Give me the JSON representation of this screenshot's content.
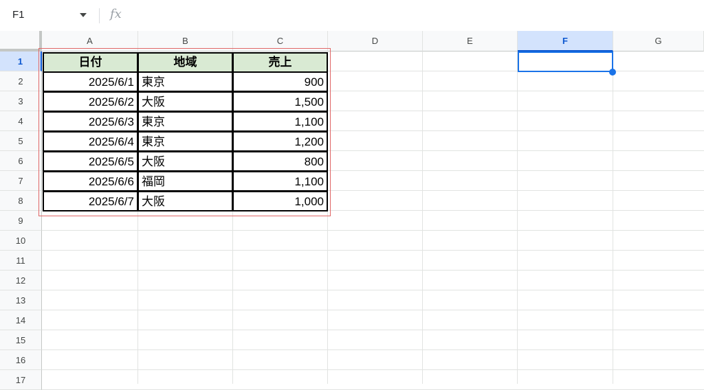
{
  "formula_bar": {
    "name_box": "F1",
    "fx": "fx",
    "formula": ""
  },
  "columns": [
    "A",
    "B",
    "C",
    "D",
    "E",
    "F",
    "G"
  ],
  "selected_column": "F",
  "rows": [
    "1",
    "2",
    "3",
    "4",
    "5",
    "6",
    "7",
    "8",
    "9",
    "10",
    "11",
    "12",
    "13",
    "14",
    "15",
    "16",
    "17"
  ],
  "selected_row": "1",
  "table": {
    "headers": [
      "日付",
      "地域",
      "売上"
    ],
    "rows": [
      [
        "2025/6/1",
        "東京",
        "900"
      ],
      [
        "2025/6/2",
        "大阪",
        "1,500"
      ],
      [
        "2025/6/3",
        "東京",
        "1,100"
      ],
      [
        "2025/6/4",
        "東京",
        "1,200"
      ],
      [
        "2025/6/5",
        "大阪",
        "800"
      ],
      [
        "2025/6/6",
        "福岡",
        "1,100"
      ],
      [
        "2025/6/7",
        "大阪",
        "1,000"
      ]
    ],
    "header_fill": "#d9ead3",
    "highlight_border": "#e06666"
  },
  "selection": {
    "cell": "F1",
    "color": "#1a73e8"
  }
}
